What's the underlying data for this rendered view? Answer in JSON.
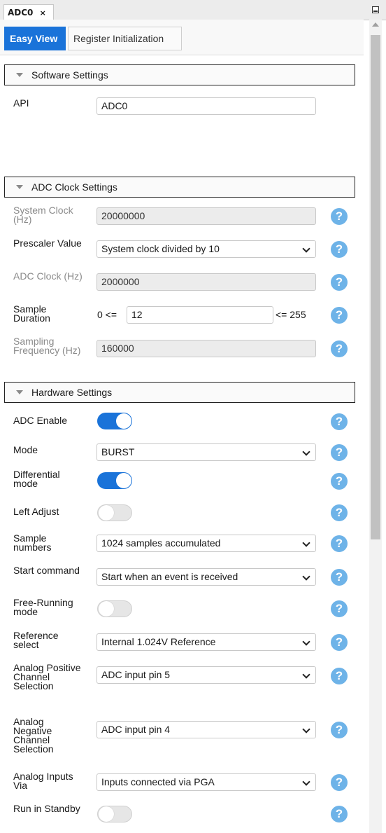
{
  "window": {
    "tab_title": "ADC0",
    "close_glyph": "×"
  },
  "view_tabs": {
    "easy_view": "Easy View",
    "register_init": "Register Initialization"
  },
  "software": {
    "title": "Software Settings",
    "api_label": "API",
    "api_value": "ADC0"
  },
  "clock": {
    "title": "ADC Clock Settings",
    "system_clock_label": "System Clock (Hz)",
    "system_clock_value": "20000000",
    "prescaler_label": "Prescaler Value",
    "prescaler_value": "System clock divided by 10",
    "adc_clock_label": "ADC Clock (Hz)",
    "adc_clock_value": "2000000",
    "sample_duration_label": "Sample Duration",
    "sample_duration_min": "0 <=",
    "sample_duration_value": "12",
    "sample_duration_max": "<= 255",
    "sampling_freq_label": "Sampling Frequency (Hz)",
    "sampling_freq_value": "160000"
  },
  "hardware": {
    "title": "Hardware Settings",
    "adc_enable_label": "ADC Enable",
    "adc_enable": true,
    "mode_label": "Mode",
    "mode_value": "BURST",
    "differential_label": "Differential mode",
    "differential": true,
    "left_adjust_label": "Left Adjust",
    "left_adjust": false,
    "sample_numbers_label": "Sample numbers",
    "sample_numbers_value": "1024 samples accumulated",
    "start_command_label": "Start command",
    "start_command_value": "Start when an event is received",
    "free_running_label": "Free-Running mode",
    "free_running": false,
    "reference_label": "Reference select",
    "reference_value": "Internal 1.024V Reference",
    "pos_channel_label": "Analog Positive Channel Selection",
    "pos_channel_value": "ADC input pin 5",
    "neg_channel_label": "Analog Negative Channel Selection",
    "neg_channel_value": "ADC input pin 4",
    "analog_inputs_label": "Analog Inputs Via",
    "analog_inputs_value": "Inputs connected via PGA",
    "run_standby_label": "Run in Standby",
    "run_standby": false
  },
  "help_glyph": "?",
  "colors": {
    "accent": "#1a73d9",
    "help": "#6eb3e8",
    "readonly_bg": "#ececec"
  }
}
